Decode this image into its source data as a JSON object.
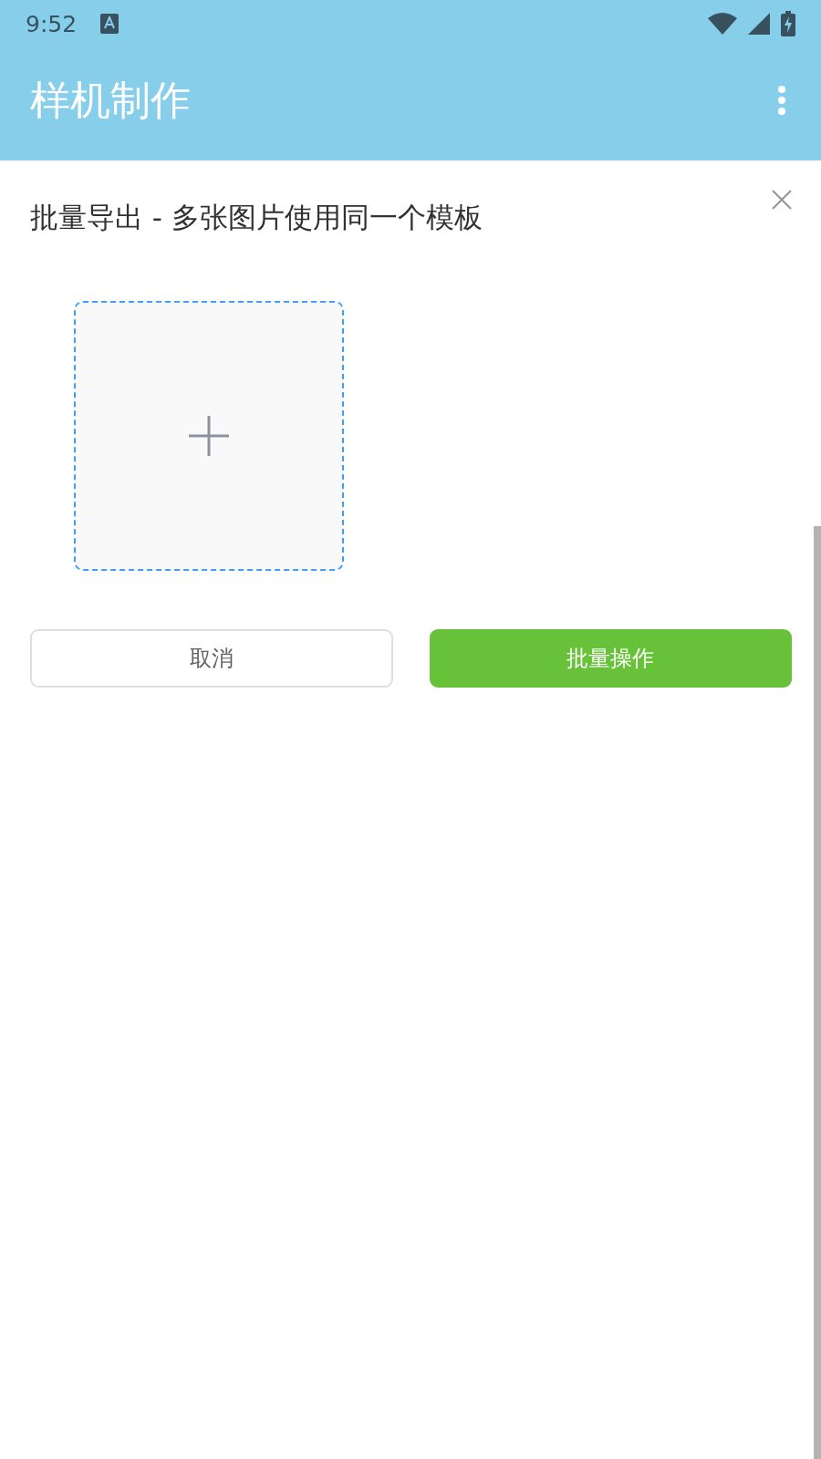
{
  "status_bar": {
    "time": "9:52"
  },
  "app_bar": {
    "title": "样机制作"
  },
  "dialog": {
    "title": "批量导出 - 多张图片使用同一个模板",
    "buttons": [
      {
        "label": "取消",
        "kind": "secondary"
      },
      {
        "label": "批量操作",
        "kind": "primary"
      }
    ]
  }
}
